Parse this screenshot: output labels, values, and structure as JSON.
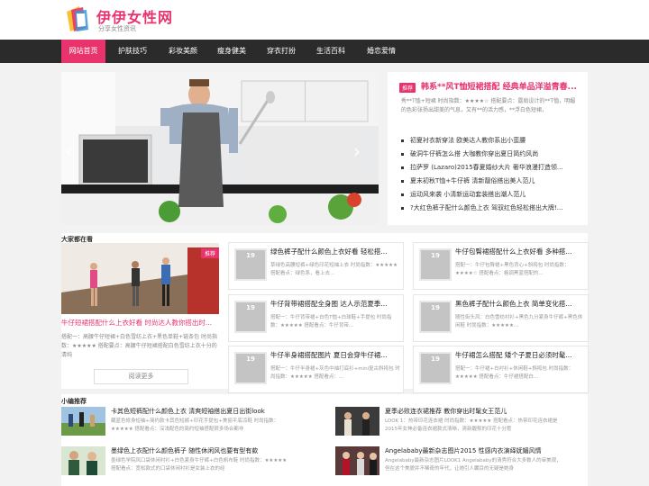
{
  "site": {
    "title": "伊伊女性网",
    "subtitle": "分享女性资讯"
  },
  "nav": {
    "items": [
      "网站首页",
      "护肤技巧",
      "彩妆美颜",
      "瘦身健美",
      "穿衣打扮",
      "生活百科",
      "婚恋爱情"
    ]
  },
  "hero": {
    "prev": "‹",
    "next": "›"
  },
  "news": {
    "tag": "推荐",
    "title": "韩系**风T恤短裙搭配 经典单品洋溢青春...",
    "desc": "秀**T恤+短裙 时尚指数：★★★★☆ 搭配要点：露肩设计的**T恤，明媚的色彩张扬出甜美的气息，又有**的活力感，**浮白色短裙，",
    "items": [
      "初夏衬衣新穿法 欧美达人教你系出小蛮腰",
      "破洞牛仔裤怎么搭 大咖教你穿出夏日简约风尚",
      "拉萨罗 (Lazaro)2015春夏婚纱大片 奢华浪漫打造领...",
      "夏末初秋T恤+牛仔裤 清新靓俗搭出美人范儿",
      "运动风来袭 小清新运动套装搭出潮人范儿",
      "?大红色裤子配什么颜色上衣 驾驭红色轻松搭出大牌!..."
    ]
  },
  "watch": {
    "section_title": "大家都在看",
    "feature": {
      "badge": "推荐",
      "title": "牛仔短裙搭配什么上衣好看 时尚达人教你搭出时...",
      "desc": "搭配一：高腰牛仔短裙+白色雪纺上衣+黑色单鞋+链条包 时尚指数：★★★★★ 搭配要点：高腰牛仔短裙搭配白色雪纺上衣十分的清纯",
      "more": "阅读更多"
    },
    "cards": [
      {
        "thumb": "19",
        "title": "绿色裤子配什么颜色上衣好看 轻松搭...",
        "desc": "草绿色高腰短裤+绿色印花短袖上衣 时尚指数：★★★★★ 搭配看点：绿色系，看上去..."
      },
      {
        "thumb": "19",
        "title": "牛仔包臀裙搭配什么上衣好看 多种搭...",
        "desc": "搭配一：牛仔包臀裙+黑色背心+斜挎包 时尚指数：★★★★☆ 搭配看点：格调黑蓝搭配的..."
      },
      {
        "thumb": "19",
        "title": "牛仔背带裙搭配全身图 达人示范夏季...",
        "desc": "搭配一：牛仔背带裙+白色T恤+白球鞋+手提包 时尚指数：★★★★★ 搭配看点：牛仔背带..."
      },
      {
        "thumb": "19",
        "title": "黑色裤子配什么颜色上衣 简单变化搭...",
        "desc": "随性街头风：白色雪纺衬衫+黑色九分紧身牛仔裤+黑色休闲鞋 时尚指数：★★★★★..."
      },
      {
        "thumb": "19",
        "title": "牛仔半身裙搭配图片 夏日会穿牛仔裙...",
        "desc": "搭配一：牛仔半身裙+灰色中袖打底衫+mini复古斜挎包 时尚指数：★★★★★ 搭配看点：..."
      },
      {
        "thumb": "19",
        "title": "牛仔裙怎么搭配 矮个子夏日必须时髦...",
        "desc": "搭配一：牛仔裙+白衬衫+休闲鞋+斜挎包 时尚指数：★★★★★ 搭配看点：牛仔裙搭配白..."
      }
    ]
  },
  "recommend": {
    "section_title": "小编推荐",
    "items": [
      {
        "title": "卡其色短裤配什么颜色上衣 清爽短袖搭出夏日出街look",
        "desc": "藏蓝色修身短袖+简约款卡其色短裤+印花手提包+美丽平底凉鞋 时尚指数：★★★★★ 搭配看点：深浅配色的简约短袖搭配很多场合都非"
      },
      {
        "title": "夏季必败连衣裙推荐 教你穿出时髦女王范儿",
        "desc": "LOOK 1：热带印花连衣裙 时尚指数：★★★★★ 搭配看点：热带印花连衣裙是2015年女神必备连衣裙款式清晰，清新馥郁的印花十分惹"
      },
      {
        "title": "墨绿色上衣配什么颜色裤子 随性休闲风也要有型有款",
        "desc": "墨绿色学院风口袋休闲衬衫+白色紧身牛仔裤+白色帆布鞋 时尚指数：★★★★★ 搭配看点：宽松款式的口袋休闲衬衫是女装上衣的经"
      },
      {
        "title": "Angelababy最新杂志图片2015 性感内衣演绎妩媚风情",
        "desc": "Angelababy最新杂志图片LOOK1 Angelababy的清秀符合大多数人的审美观，但在这个美貌并不稀奇的年代，让她引人瞩目的无疑是她身"
      }
    ]
  }
}
